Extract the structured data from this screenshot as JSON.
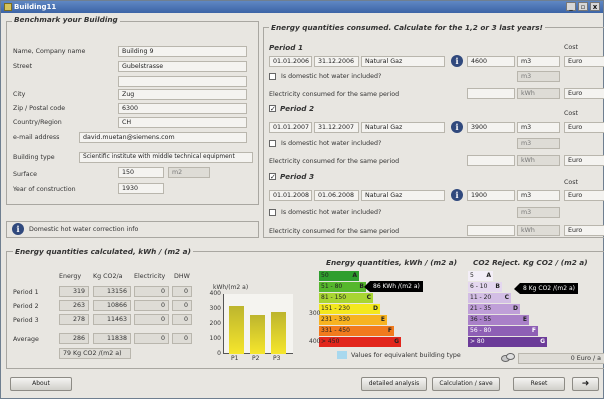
{
  "window": {
    "title": "Building11",
    "buttons": [
      "_",
      "▫",
      "x"
    ]
  },
  "benchmark": {
    "title": "Benchmark your Building",
    "name_label": "Name, Company name",
    "name_value": "Building 9",
    "street_label": "Street",
    "street_value": "Gubelstrasse",
    "street2_value": "",
    "city_label": "City",
    "city_value": "Zug",
    "zip_label": "Zip / Postal code",
    "zip_value": "6300",
    "country_label": "Country/Region",
    "country_value": "CH",
    "email_label": "e-mail address",
    "email_value": "david.muetan@siemens.com",
    "type_label": "Building type",
    "type_value": "Scientific institute with middle technical equipment",
    "surface_label": "Surface",
    "surface_value": "150",
    "surface_unit": "m2",
    "year_label": "Year of construction",
    "year_value": "1930"
  },
  "hotwater_info": "Domestic hot water correction info",
  "consumed": {
    "title": "Energy quantities consumed. Calculate for the 1,2 or 3 last years!",
    "cost_label": "Cost",
    "hot_water_question": "Is domestic hot water included?",
    "electricity_label": "Electricity consumed for the same period",
    "periods": [
      {
        "label": "Period 1",
        "checked": false,
        "from": "01.01.2006",
        "to": "31.12.2006",
        "fuel": "Natural Gaz",
        "qty": "4600",
        "unit": "m3",
        "hw_unit": "m3",
        "elec_unit": "kWh",
        "currency": "Euro",
        "hw_currency": "Euro"
      },
      {
        "label": "Period 2",
        "checked": true,
        "from": "01.01.2007",
        "to": "31.12.2007",
        "fuel": "Natural Gaz",
        "qty": "3900",
        "unit": "m3",
        "hw_unit": "m3",
        "elec_unit": "kWh",
        "currency": "Euro",
        "hw_currency": "Euro"
      },
      {
        "label": "Period 3",
        "checked": true,
        "from": "01.01.2008",
        "to": "01.06.2008",
        "fuel": "Natural Gaz",
        "qty": "1900",
        "unit": "m3",
        "hw_unit": "m3",
        "elec_unit": "kWh",
        "currency": "Euro",
        "hw_currency": "Euro"
      }
    ]
  },
  "calculated": {
    "title": "Energy quantities calculated, kWh / (m2 a)",
    "headers": [
      "Energy",
      "Kg CO2/a",
      "Electricity",
      "DHW"
    ],
    "rows": [
      {
        "label": "Period 1",
        "energy": "319",
        "co2": "13156",
        "elec": "0",
        "dhw": "0"
      },
      {
        "label": "Period 2",
        "energy": "263",
        "co2": "10866",
        "elec": "0",
        "dhw": "0"
      },
      {
        "label": "Period 3",
        "energy": "278",
        "co2": "11463",
        "elec": "0",
        "dhw": "0"
      },
      {
        "label": "Average",
        "energy": "286",
        "co2": "11838",
        "elec": "0",
        "dhw": "0"
      }
    ],
    "co2_note": "79 Kg CO2 /(m2 a)"
  },
  "chart_data": {
    "type": "bar",
    "ylabel": "kWh/(m2 a)",
    "categories": [
      "P1",
      "P2",
      "P3"
    ],
    "values": [
      319,
      263,
      278
    ],
    "ylim": [
      0,
      400
    ],
    "yticks": [
      "0",
      "100",
      "200",
      "300",
      "400"
    ]
  },
  "energy_scale": {
    "title": "Energy quantities, kWh / (m2 a)",
    "bands": [
      {
        "range": "50",
        "letter": "A",
        "color": "#2e9e2e"
      },
      {
        "range": "51 - 80",
        "letter": "B",
        "color": "#55b72c"
      },
      {
        "range": "81 - 150",
        "letter": "C",
        "color": "#a8d532"
      },
      {
        "range": "151 - 230",
        "letter": "D",
        "color": "#f4e81e"
      },
      {
        "range": "231 - 330",
        "letter": "E",
        "color": "#f7b321"
      },
      {
        "range": "331 - 450",
        "letter": "F",
        "color": "#f17a1d"
      },
      {
        "range": "> 450",
        "letter": "G",
        "color": "#e2261c"
      }
    ],
    "pointer": "86 KWh /(m2 a)",
    "marker_300": "300",
    "marker_400": "400",
    "legend": "Values for equivalent building type"
  },
  "co2_scale": {
    "title": "CO2 Reject. Kg CO2 / (m2 a)",
    "bands": [
      {
        "range": "5",
        "letter": "A",
        "color": "#f3eef7"
      },
      {
        "range": "6 - 10",
        "letter": "B",
        "color": "#e4d7ef"
      },
      {
        "range": "11 - 20",
        "letter": "C",
        "color": "#d3bee5"
      },
      {
        "range": "21 - 35",
        "letter": "D",
        "color": "#bf9fd8"
      },
      {
        "range": "36 - 55",
        "letter": "E",
        "color": "#a980c8"
      },
      {
        "range": "56 - 80",
        "letter": "F",
        "color": "#8e5fb5"
      },
      {
        "range": "> 80",
        "letter": "G",
        "color": "#6b3b98"
      }
    ],
    "pointer": "8 Kg CO2 /(m2 a)"
  },
  "total_cost": "0 Euro / a",
  "footer": {
    "about": "About",
    "detailed": "detailed analysis",
    "calc": "Calculation / save",
    "reset": "Reset",
    "exit": "➜"
  }
}
